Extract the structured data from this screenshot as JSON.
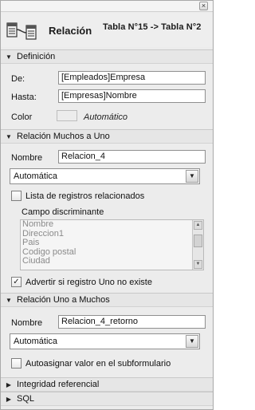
{
  "window": {
    "close_glyph": "×"
  },
  "header": {
    "title": "Relación",
    "tables": "Tabla N°15 -> Tabla N°2",
    "icon": "relation-icon"
  },
  "definicion": {
    "heading": "Definición",
    "de_label": "De:",
    "de_value": "[Empleados]Empresa",
    "hasta_label": "Hasta:",
    "hasta_value": "[Empresas]Nombre",
    "color_label": "Color",
    "color_value": "Automático"
  },
  "muchos_a_uno": {
    "heading": "Relación Muchos a Uno",
    "nombre_label": "Nombre",
    "nombre_value": "Relacion_4",
    "select_value": "Automática",
    "lista_label": "Lista de registros relacionados",
    "lista_checked": false,
    "campo_label": "Campo discriminante",
    "campo_items": [
      "Nombre",
      "Direccion1",
      "Pais",
      "Codigo postal",
      "Ciudad"
    ],
    "advertir_label": "Advertir si registro Uno no existe",
    "advertir_checked": true
  },
  "uno_a_muchos": {
    "heading": "Relación Uno a Muchos",
    "nombre_label": "Nombre",
    "nombre_value": "Relacion_4_retorno",
    "select_value": "Automática",
    "auto_label": "Autoasignar valor en el subformulario",
    "auto_checked": false
  },
  "integridad": {
    "heading": "Integridad referencial"
  },
  "sql": {
    "heading": "SQL"
  },
  "glyphs": {
    "expanded": "▼",
    "collapsed": "▶",
    "check": "✓",
    "dropdown": "▼"
  }
}
